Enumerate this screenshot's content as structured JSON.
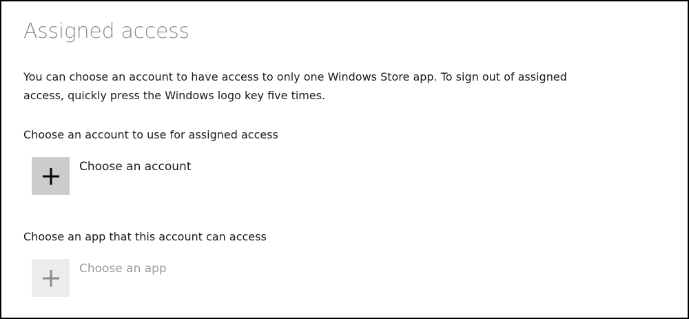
{
  "page": {
    "title": "Assigned access",
    "description": "You can choose an account to have access to only one Windows Store app. To sign out of assigned access, quickly press the Windows logo key five times."
  },
  "account_section": {
    "label": "Choose an account to use for assigned access",
    "button_label": "Choose an account",
    "icon": "plus-icon",
    "enabled": true
  },
  "app_section": {
    "label": "Choose an app that this account can access",
    "button_label": "Choose an app",
    "icon": "plus-icon",
    "enabled": false
  },
  "colors": {
    "title": "#8c8c8c",
    "text": "#1a1a1a",
    "disabled_text": "#9a9a9a",
    "tile_active": "#cccccc",
    "tile_disabled": "#ececec",
    "plus_active": "#000000",
    "plus_disabled": "#8a8a8a"
  }
}
